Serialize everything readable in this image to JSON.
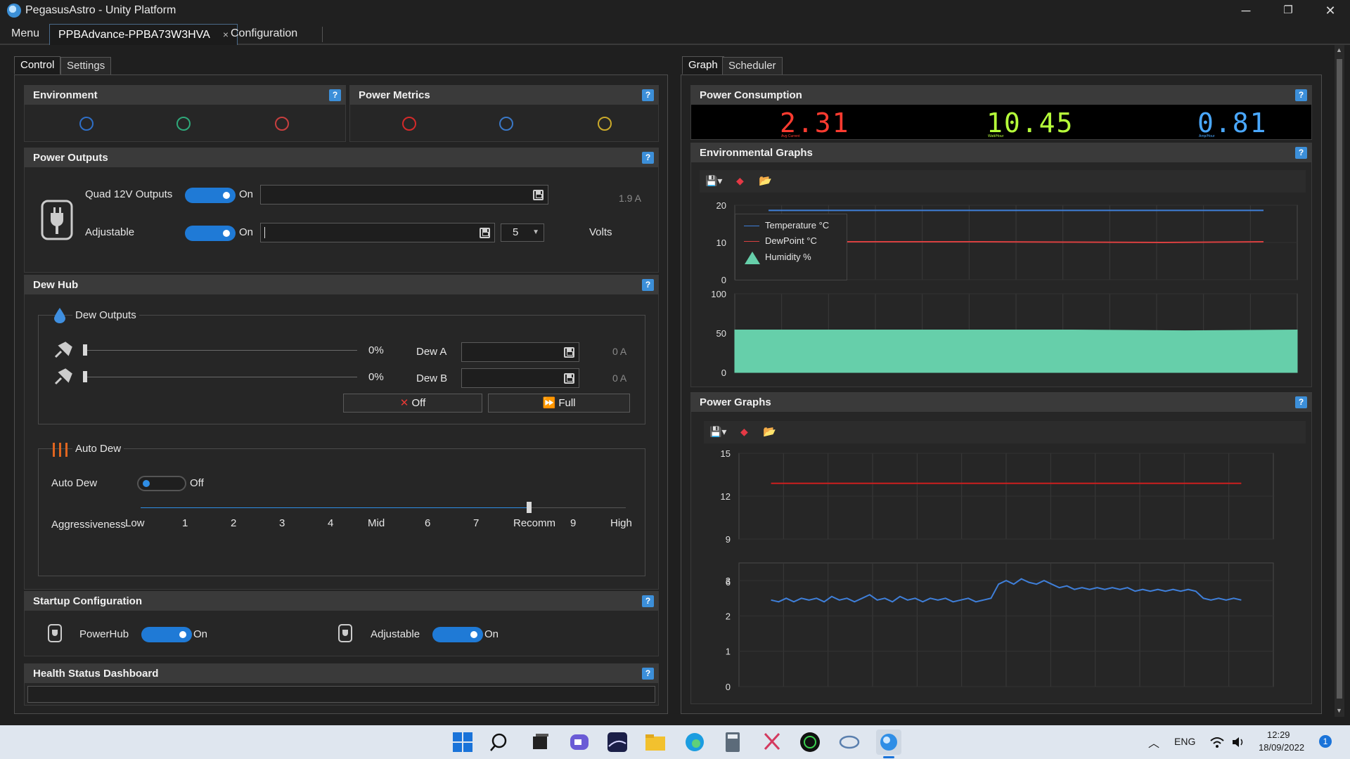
{
  "window": {
    "title": "PegasusAstro - Unity Platform",
    "min": "─",
    "max": "❐",
    "close": "✕"
  },
  "tabs": {
    "menu": "Menu",
    "device": "PPBAdvance-PPBA73W3HVA",
    "device_close": "×",
    "config": "Configuration"
  },
  "left_tabs": [
    "Control",
    "Settings"
  ],
  "right_tabs": [
    "Graph",
    "Scheduler"
  ],
  "help": "?",
  "environment": {
    "title": "Environment"
  },
  "power_metrics": {
    "title": "Power Metrics"
  },
  "power_outputs": {
    "title": "Power Outputs",
    "quad_label": "Quad 12V Outputs",
    "quad_state": "On",
    "quad_current": "1.9 A",
    "adj_label": "Adjustable",
    "adj_state": "On",
    "adj_voltage": "5",
    "adj_unit": "Volts"
  },
  "dew_hub": {
    "title": "Dew Hub",
    "outputs_title": "Dew Outputs",
    "dew_a": {
      "pct": "0%",
      "label": "Dew A",
      "current": "0 A"
    },
    "dew_b": {
      "pct": "0%",
      "label": "Dew B",
      "current": "0 A"
    },
    "off_btn": "Off",
    "full_btn": "Full",
    "auto_title": "Auto Dew",
    "auto_label": "Auto Dew",
    "auto_state": "Off",
    "aggr_label": "Aggressiveness",
    "aggr_ticks": [
      "Low",
      "1",
      "2",
      "3",
      "4",
      "Mid",
      "6",
      "7",
      "Recomm",
      "9",
      "High"
    ],
    "aggr_value_fraction": 0.8
  },
  "startup": {
    "title": "Startup Configuration",
    "powerhub_label": "PowerHub",
    "powerhub_state": "On",
    "adj_label": "Adjustable",
    "adj_state": "On"
  },
  "health": {
    "title": "Health Status Dashboard"
  },
  "power_consumption": {
    "title": "Power Consumption",
    "values": [
      {
        "value": "2.31",
        "caption": "Avg Current",
        "color": "#ff3b30"
      },
      {
        "value": "10.45",
        "caption": "Watt/Hour",
        "color": "#b6ff3a"
      },
      {
        "value": "0.81",
        "caption": "Amp/Hour",
        "color": "#4aa8ff"
      }
    ]
  },
  "env_graphs": {
    "title": "Environmental Graphs",
    "legend": [
      "Temperature °C",
      "DewPoint °C",
      "Humidity %"
    ],
    "colors": {
      "temperature": "#3f7fd9",
      "dewpoint": "#d94040",
      "humidity": "#66cfaa"
    }
  },
  "power_graphs": {
    "title": "Power Graphs",
    "line_color": "#3f7fd9",
    "limit_color": "#cc1f1f"
  },
  "chart_data": [
    {
      "type": "line",
      "series": [
        {
          "name": "Temperature °C",
          "values": [
            18.6,
            18.6,
            18.6,
            18.6,
            18.6,
            18.6
          ]
        },
        {
          "name": "DewPoint °C",
          "values": [
            10.2,
            10.2,
            10.2,
            10.1,
            10.0,
            10.2
          ]
        }
      ],
      "ylim": [
        0,
        20
      ],
      "yticks": [
        "20",
        "10",
        "0"
      ]
    },
    {
      "type": "area",
      "series": [
        {
          "name": "Humidity %",
          "values": [
            54,
            54,
            54,
            54,
            53,
            54
          ]
        }
      ],
      "ylim": [
        0,
        100
      ],
      "yticks": [
        "100",
        "50",
        "0"
      ]
    },
    {
      "type": "line",
      "series": [
        {
          "values": [
            12.9,
            12.9,
            12.9,
            12.9,
            12.9,
            12.9,
            12.9
          ]
        }
      ],
      "ylim": [
        9,
        15
      ],
      "yticks": [
        "15",
        "12",
        "9",
        "6"
      ]
    },
    {
      "type": "line",
      "series": [
        {
          "values": [
            2.45,
            2.4,
            2.5,
            2.4,
            2.5,
            2.45,
            2.5,
            2.4,
            2.55,
            2.45,
            2.5,
            2.4,
            2.5,
            2.6,
            2.45,
            2.5,
            2.4,
            2.55,
            2.45,
            2.5,
            2.4,
            2.5,
            2.45,
            2.5,
            2.4,
            2.45,
            2.5,
            2.4,
            2.45,
            2.5,
            2.9,
            3.0,
            2.9,
            3.05,
            2.95,
            2.9,
            3.0,
            2.9,
            2.8,
            2.85,
            2.75,
            2.8,
            2.75,
            2.8,
            2.75,
            2.8,
            2.75,
            2.8,
            2.7,
            2.75,
            2.7,
            2.75,
            2.7,
            2.75,
            2.7,
            2.75,
            2.7,
            2.5,
            2.45,
            2.5,
            2.45,
            2.5,
            2.45
          ]
        }
      ],
      "ylim": [
        0,
        3.5
      ],
      "yticks": [
        "3",
        "2",
        "1",
        "0"
      ]
    }
  ],
  "taskbar": {
    "lang": "ENG",
    "time": "12:29",
    "date": "18/09/2022",
    "notif": "1"
  }
}
